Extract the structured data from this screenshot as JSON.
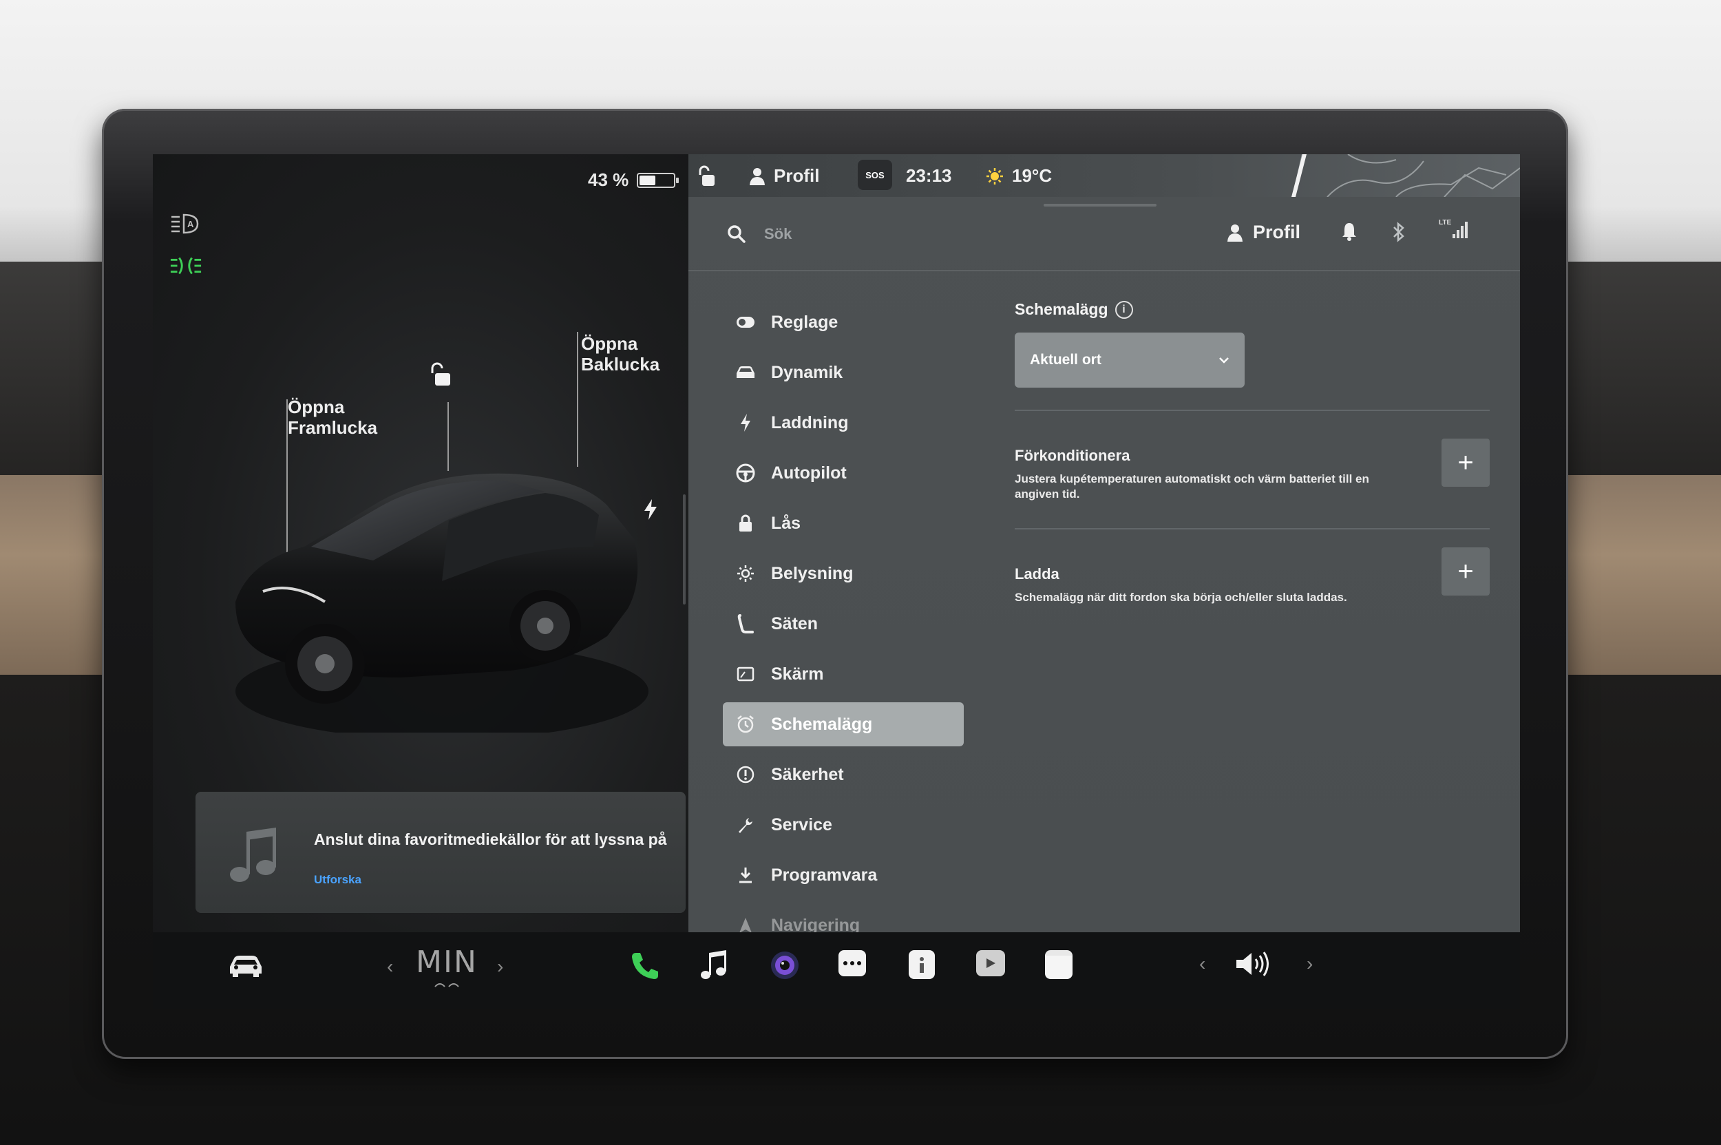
{
  "status": {
    "battery_percent": "43 %",
    "battery_level": 0.43,
    "profile_label": "Profil",
    "sos_label": "SOS",
    "time": "23:13",
    "temperature": "19°C"
  },
  "car_panel": {
    "front_trunk_line1": "Öppna",
    "front_trunk_line2": "Framlucka",
    "rear_trunk_line1": "Öppna",
    "rear_trunk_line2": "Baklucka"
  },
  "media": {
    "title": "Anslut dina favoritmediekällor för att lyssna på",
    "link": "Utforska"
  },
  "header": {
    "search_placeholder": "Sök",
    "profile_label": "Profil",
    "lte_label": "LTE"
  },
  "sidebar": {
    "items": [
      {
        "label": "Reglage",
        "icon": "toggle-icon"
      },
      {
        "label": "Dynamik",
        "icon": "car-icon"
      },
      {
        "label": "Laddning",
        "icon": "bolt-icon"
      },
      {
        "label": "Autopilot",
        "icon": "steering-wheel-icon"
      },
      {
        "label": "Lås",
        "icon": "lock-icon"
      },
      {
        "label": "Belysning",
        "icon": "sun-icon"
      },
      {
        "label": "Säten",
        "icon": "seat-icon"
      },
      {
        "label": "Skärm",
        "icon": "display-icon"
      },
      {
        "label": "Schemalägg",
        "icon": "alarm-clock-icon",
        "active": true
      },
      {
        "label": "Säkerhet",
        "icon": "alert-circle-icon"
      },
      {
        "label": "Service",
        "icon": "wrench-icon"
      },
      {
        "label": "Programvara",
        "icon": "download-icon"
      },
      {
        "label": "Navigering",
        "icon": "navigation-icon"
      }
    ]
  },
  "content": {
    "section_title": "Schemalägg",
    "dropdown_value": "Aktuell ort",
    "rows": [
      {
        "title": "Förkonditionera",
        "description": "Justera kupétemperaturen automatiskt och värm batteriet till en angiven tid."
      },
      {
        "title": "Ladda",
        "description": "Schemalägg när ditt fordon ska börja och/eller sluta laddas."
      }
    ],
    "plus_label": "+"
  },
  "bottombar": {
    "climate_label": "MIN",
    "chevron_left": "‹",
    "chevron_right": "›"
  },
  "colors": {
    "accent_green": "#3ecf57",
    "link_blue": "#4aa3ff",
    "active_item": "#a7acad"
  }
}
